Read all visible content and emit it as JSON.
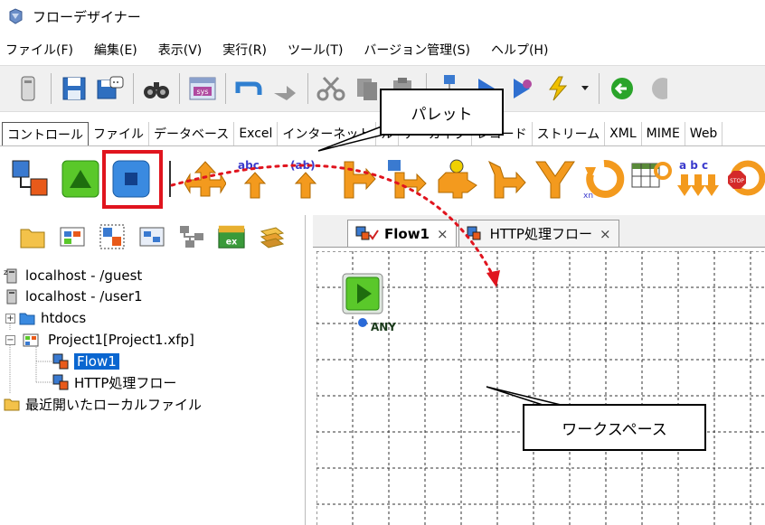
{
  "window": {
    "title": "フローデザイナー"
  },
  "menu": [
    "ファイル(F)",
    "編集(E)",
    "表示(V)",
    "実行(R)",
    "ツール(T)",
    "バージョン管理(S)",
    "ヘルプ(H)"
  ],
  "palette_tabs": [
    "コントロール",
    "ファイル",
    "データベース",
    "Excel",
    "インターネット",
    "ル",
    "アーカイブ",
    "レコード",
    "ストリーム",
    "XML",
    "MIME",
    "Web"
  ],
  "palette_icon_labels": {
    "abc": "abc",
    "ab": "(ab)",
    "abc_split": "a b c",
    "stop": "STOP",
    "xn": "xn",
    "sys": "sys",
    "ex": "ex",
    "any": "ANY",
    "toolbar_01": "01"
  },
  "tree": [
    {
      "label": "localhost - /guest"
    },
    {
      "label": "localhost - /user1"
    },
    {
      "label": "htdocs"
    },
    {
      "label": "Project1[Project1.xfp]"
    },
    {
      "label": "Flow1",
      "selected": true
    },
    {
      "label": "HTTP処理フロー"
    },
    {
      "label": "最近開いたローカルファイル"
    }
  ],
  "workspace_tabs": [
    {
      "label": "Flow1",
      "active": true,
      "close": "×"
    },
    {
      "label": "HTTP処理フロー",
      "active": false,
      "close": "×"
    }
  ],
  "callouts": {
    "palette": "パレット",
    "workspace": "ワークスペース"
  },
  "colors": {
    "highlight": "#e0141e",
    "selection": "#0a66d0",
    "arrow_orange": "#f39a1e"
  }
}
